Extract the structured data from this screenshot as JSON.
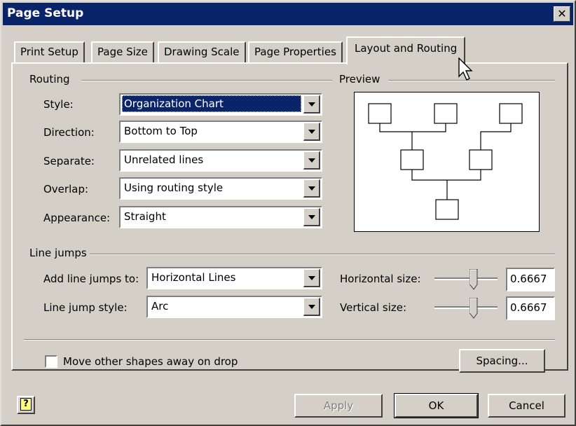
{
  "window": {
    "title": "Page Setup",
    "close_glyph": "✕"
  },
  "tabs": [
    {
      "label": "Print Setup"
    },
    {
      "label": "Page Size"
    },
    {
      "label": "Drawing Scale"
    },
    {
      "label": "Page Properties"
    },
    {
      "label": "Layout and Routing",
      "active": true
    }
  ],
  "routing": {
    "group_label": "Routing",
    "style": {
      "label": "Style:",
      "value": "Organization Chart"
    },
    "direction": {
      "label": "Direction:",
      "value": "Bottom to Top"
    },
    "separate": {
      "label": "Separate:",
      "value": "Unrelated lines"
    },
    "overlap": {
      "label": "Overlap:",
      "value": "Using routing style"
    },
    "appearance": {
      "label": "Appearance:",
      "value": "Straight"
    }
  },
  "preview": {
    "group_label": "Preview"
  },
  "line_jumps": {
    "group_label": "Line jumps",
    "add_to": {
      "label": "Add line jumps to:",
      "value": "Horizontal Lines"
    },
    "style": {
      "label": "Line jump style:",
      "value": "Arc"
    },
    "horizontal_size": {
      "label": "Horizontal size:",
      "value": "0.6667"
    },
    "vertical_size": {
      "label": "Vertical size:",
      "value": "0.6667"
    }
  },
  "move_shapes": {
    "label": "Move other shapes away on drop",
    "checked": false
  },
  "buttons": {
    "spacing": "Spacing...",
    "apply": "Apply",
    "ok": "OK",
    "cancel": "Cancel",
    "help_glyph": "?"
  },
  "icons": {
    "close": "close-icon",
    "help": "help-icon",
    "cursor": "arrow-help-cursor-icon",
    "dropdown": "chevron-down-icon"
  }
}
